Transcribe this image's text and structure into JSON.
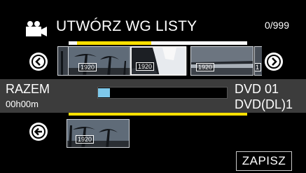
{
  "header": {
    "camera_icon": "movie-camera-icon",
    "title": "UTWÓRZ WG LISTY",
    "counter": "0/999"
  },
  "source_strip": {
    "scroll_position_fraction": 0.05,
    "thumbnails": [
      {
        "badge": "1920"
      },
      {
        "badge": "1920",
        "selected": true
      },
      {
        "badge": "1920"
      },
      {
        "badge": "1"
      }
    ],
    "prev_icon": "chevron-left-circle-icon",
    "next_icon": "chevron-right-circle-icon"
  },
  "summary": {
    "label": "RAZEM",
    "duration": "00h00m",
    "progress_fraction": 0.09,
    "disc_line1": "DVD  01",
    "disc_line2": "DVD(DL)1"
  },
  "playlist": {
    "back_icon": "arrow-left-circle-icon",
    "thumbnails": [
      {
        "badge": "1920"
      }
    ]
  },
  "actions": {
    "save_label": "ZAPISZ"
  },
  "colors": {
    "accent_yellow": "#ffe000",
    "progress_blue": "#7ec8ea",
    "info_bar_gray": "#3c3c3c"
  }
}
